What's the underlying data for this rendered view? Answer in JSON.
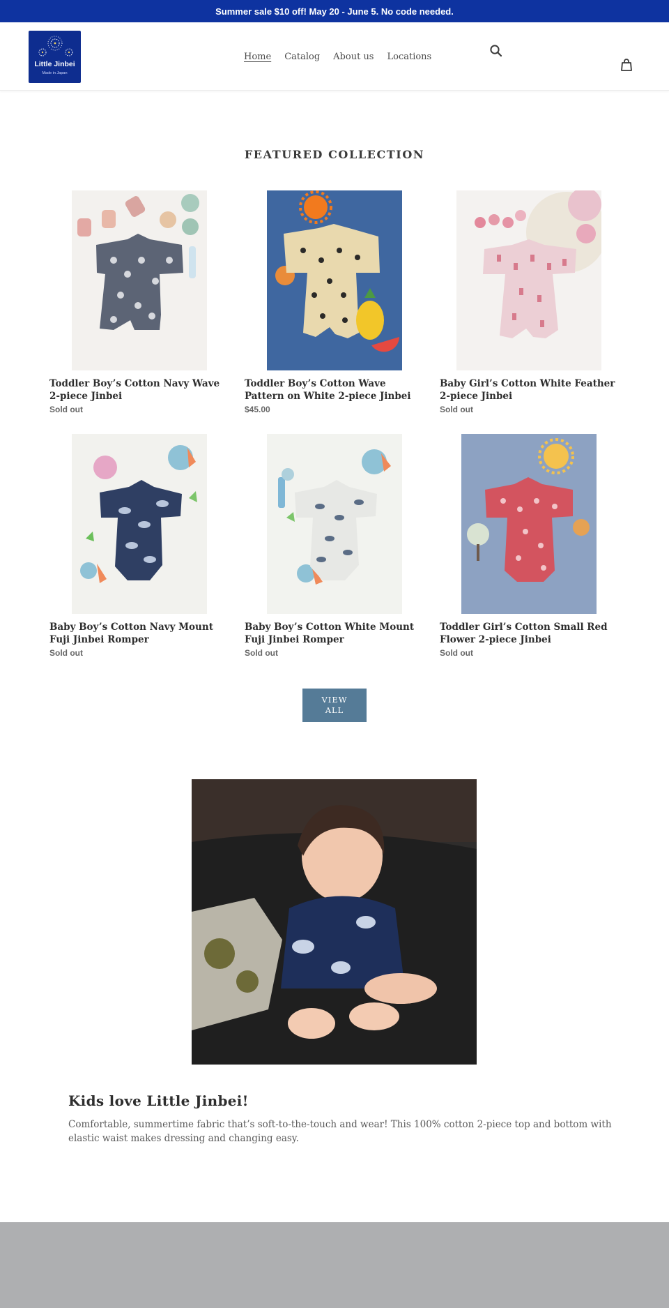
{
  "announcement": {
    "text": "Summer sale $10 off! May 20 - June 5. No code needed."
  },
  "brand": {
    "name": "Little Jinbei",
    "tagline": "Made in Japan",
    "color": "#0e2d8f"
  },
  "nav": [
    {
      "label": "Home",
      "active": true
    },
    {
      "label": "Catalog",
      "active": false
    },
    {
      "label": "About us",
      "active": false
    },
    {
      "label": "Locations",
      "active": false
    }
  ],
  "icons": {
    "search": "search-icon",
    "cart": "cart-icon"
  },
  "featured": {
    "title": "FEATURED COLLECTION",
    "products": [
      {
        "title": "Toddler Boy’s Cotton Navy Wave 2-piece Jinbei",
        "price": "Sold out"
      },
      {
        "title": "Toddler Boy’s Cotton Wave Pattern on White 2-piece Jinbei",
        "price": "$45.00"
      },
      {
        "title": "Baby Girl’s Cotton White Feather 2-piece Jinbei",
        "price": "Sold out"
      },
      {
        "title": "Baby Boy’s Cotton Navy Mount Fuji Jinbei Romper",
        "price": "Sold out"
      },
      {
        "title": "Baby Boy’s Cotton White Mount Fuji Jinbei Romper",
        "price": "Sold out"
      },
      {
        "title": "Toddler Girl’s Cotton Small Red Flower 2-piece Jinbei",
        "price": "Sold out"
      }
    ],
    "view_all_label": "VIEW ALL"
  },
  "feature_text": {
    "heading": "Kids love Little Jinbei!",
    "body": "Comfortable, summertime fabric that’s soft-to-the-touch and wear! This 100% cotton 2-piece top and bottom with elastic waist makes dressing and changing easy."
  },
  "colors": {
    "announcement_bg": "#0e33a0",
    "button_bg": "#557b97",
    "footer_bg": "#aeafb1"
  }
}
